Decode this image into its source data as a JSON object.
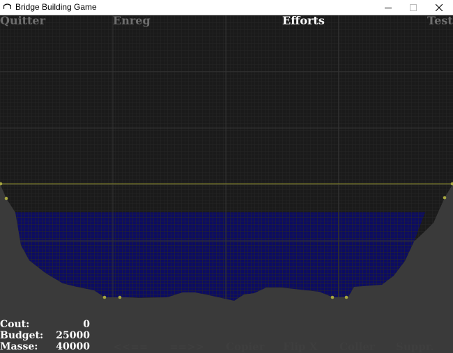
{
  "window": {
    "title": "Bridge Building Game"
  },
  "menu": {
    "quit": "Quitter",
    "save": "Enreg",
    "stress": "Efforts",
    "test": "Test",
    "active": "stress"
  },
  "stats": {
    "cost_label": "Cout:",
    "cost_value": "0",
    "budget_label": "Budget:",
    "budget_value": "25000",
    "mass_label": "Masse:",
    "mass_value": "40000"
  },
  "toolbar": {
    "prev": "<<==",
    "next": "==>>",
    "copy": "Copier",
    "flip": "Flip X",
    "paste": "Coller",
    "delete": "Suppr."
  },
  "colors": {
    "background": "#1a1a1a",
    "grid": "#2b2b2b",
    "water": "#0c0c62",
    "terrain": "#3a3a3a",
    "deck_line": "#8a8a2a",
    "anchor": "#a6a640",
    "menu_inactive": "#6e6e6e",
    "menu_active": "#ffffff",
    "toolbar_text": "#3e3e3e"
  },
  "icons": {
    "app": "bridge-icon",
    "minimize": "minimize-icon",
    "maximize": "maximize-icon",
    "close": "close-icon"
  }
}
